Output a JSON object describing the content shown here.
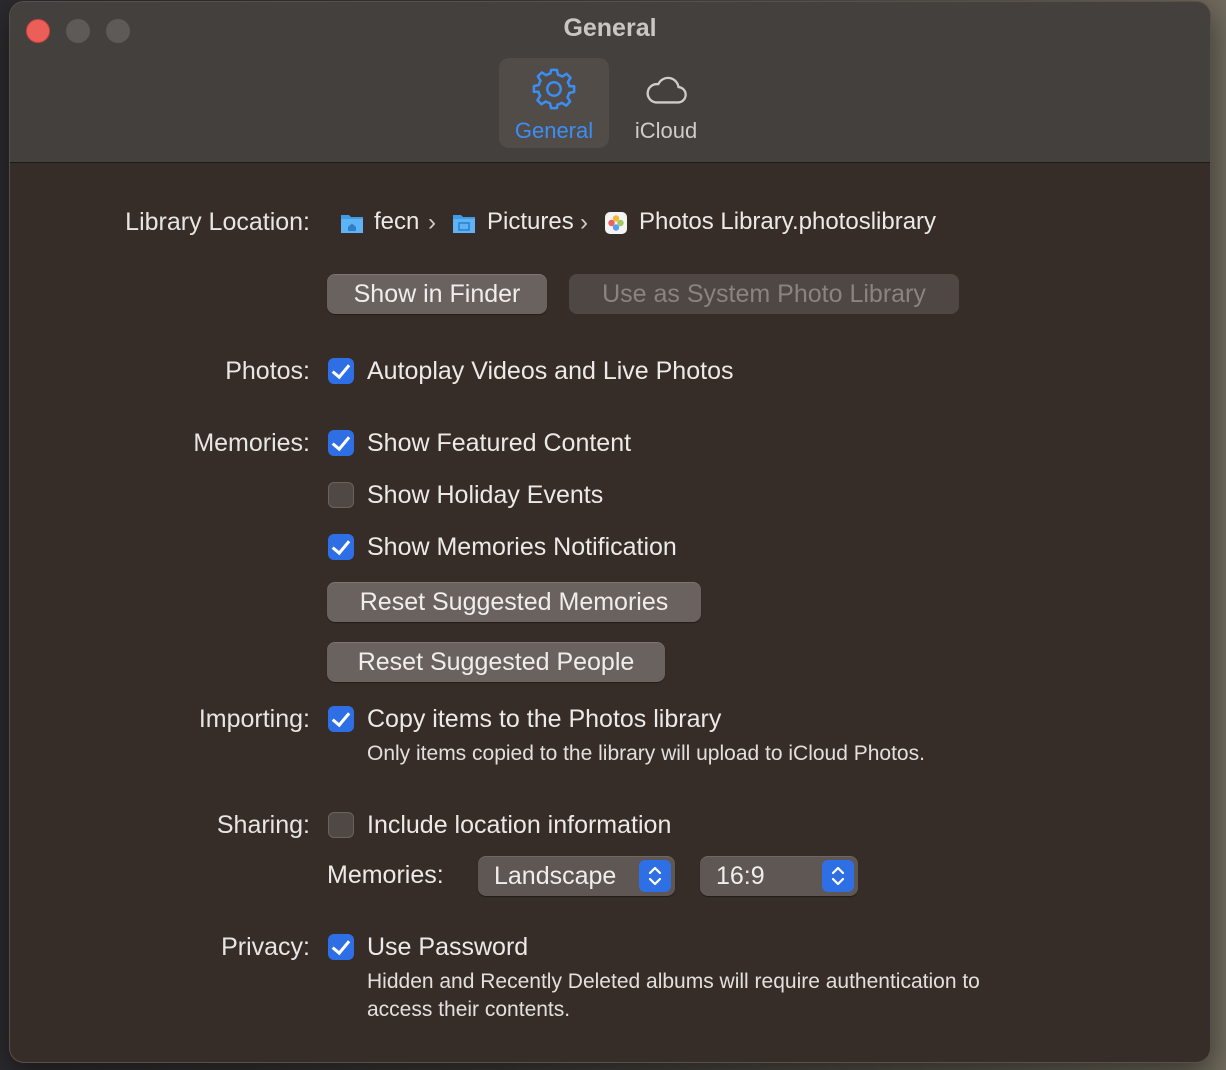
{
  "window": {
    "title": "General"
  },
  "toolbar": {
    "tabs": [
      {
        "label": "General",
        "icon": "gear-icon",
        "selected": true
      },
      {
        "label": "iCloud",
        "icon": "cloud-icon",
        "selected": false
      }
    ]
  },
  "library": {
    "label": "Library Location:",
    "path": [
      {
        "name": "fecn",
        "icon": "home-folder-icon"
      },
      {
        "name": "Pictures",
        "icon": "pictures-folder-icon"
      },
      {
        "name": "Photos Library.photoslibrary",
        "icon": "photos-library-icon"
      }
    ],
    "show_in_finder": "Show in Finder",
    "use_as_system": "Use as System Photo Library"
  },
  "photos": {
    "label": "Photos:",
    "autoplay": {
      "label": "Autoplay Videos and Live Photos",
      "checked": true
    }
  },
  "memories": {
    "label": "Memories:",
    "featured": {
      "label": "Show Featured Content",
      "checked": true
    },
    "holiday": {
      "label": "Show Holiday Events",
      "checked": false
    },
    "notification": {
      "label": "Show Memories Notification",
      "checked": true
    },
    "reset_memories": "Reset Suggested Memories",
    "reset_people": "Reset Suggested People"
  },
  "importing": {
    "label": "Importing:",
    "copy": {
      "label": "Copy items to the Photos library",
      "checked": true
    },
    "note": "Only items copied to the library will upload to iCloud Photos."
  },
  "sharing": {
    "label": "Sharing:",
    "location": {
      "label": "Include location information",
      "checked": false
    },
    "memories_label": "Memories:",
    "orientation": "Landscape",
    "aspect": "16:9"
  },
  "privacy": {
    "label": "Privacy:",
    "password": {
      "label": "Use Password",
      "checked": true
    },
    "note_line1": "Hidden and Recently Deleted albums will require authentication to",
    "note_line2": "access their contents."
  },
  "colors": {
    "accent": "#3b8ef5",
    "checkbox": "#2f6fe6",
    "close": "#ec5f58"
  }
}
